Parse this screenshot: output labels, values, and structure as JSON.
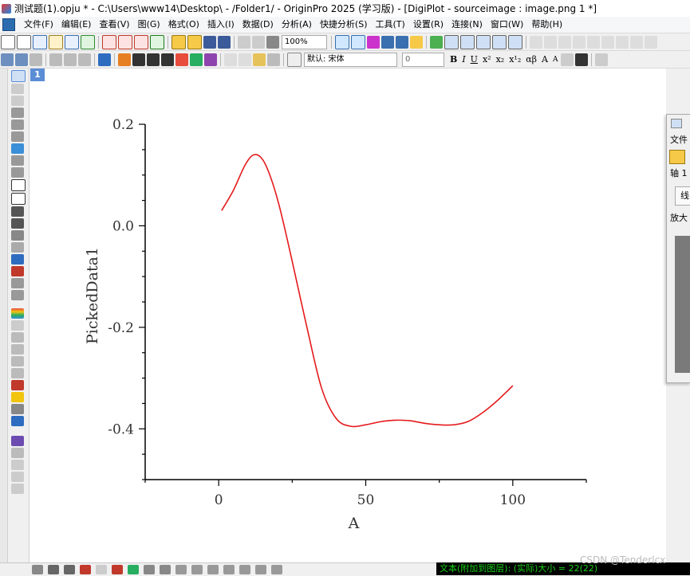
{
  "window": {
    "title": "测试题(1).opju * - C:\\Users\\www14\\Desktop\\ - /Folder1/ - OriginPro 2025 (学习版) - [DigiPlot - sourceimage : image.png 1 *]"
  },
  "menu": [
    "文件(F)",
    "编辑(E)",
    "查看(V)",
    "图(G)",
    "格式(O)",
    "插入(I)",
    "数据(D)",
    "分析(A)",
    "快捷分析(S)",
    "工具(T)",
    "设置(R)",
    "连接(N)",
    "窗口(W)",
    "帮助(H)"
  ],
  "toolbar": {
    "zoom": "100%",
    "font": "默认: 宋体",
    "font_size": "0",
    "format_buttons": [
      "B",
      "I",
      "U",
      "x²",
      "x₂",
      "x¹₂",
      "αβ",
      "A",
      "A"
    ]
  },
  "layer_badge": "1",
  "chart_data": {
    "type": "line",
    "xlabel": "A",
    "ylabel": "PickedData1",
    "xlim": [
      -25,
      125
    ],
    "ylim": [
      -0.5,
      0.2
    ],
    "x_ticks": [
      0,
      50,
      100
    ],
    "y_ticks": [
      0.2,
      0.0,
      -0.2,
      -0.4
    ],
    "x_tick_labels": [
      "0",
      "50",
      "100"
    ],
    "y_tick_labels": [
      "0.2",
      "0.0",
      "-0.2",
      "-0.4"
    ],
    "grid": false,
    "color": "#e41a1c",
    "series": [
      {
        "x": [
          1,
          5,
          9,
          12,
          15,
          18,
          21,
          25,
          30,
          35,
          40,
          45,
          50,
          55,
          60,
          65,
          70,
          75,
          80,
          85,
          90,
          95,
          100
        ],
        "y": [
          0.03,
          0.07,
          0.12,
          0.14,
          0.13,
          0.09,
          0.03,
          -0.07,
          -0.2,
          -0.32,
          -0.38,
          -0.395,
          -0.392,
          -0.386,
          -0.383,
          -0.384,
          -0.389,
          -0.392,
          -0.392,
          -0.385,
          -0.367,
          -0.343,
          -0.315
        ]
      }
    ]
  },
  "side_panel": {
    "file_label": "文件",
    "axis_label": "轴 1",
    "tab_label": "线",
    "zoom_label": "放大"
  },
  "status": {
    "text": "文本(附加到图层): (实际)大小 = 22(22)"
  },
  "watermark": "CSDN @Tenderlcx"
}
